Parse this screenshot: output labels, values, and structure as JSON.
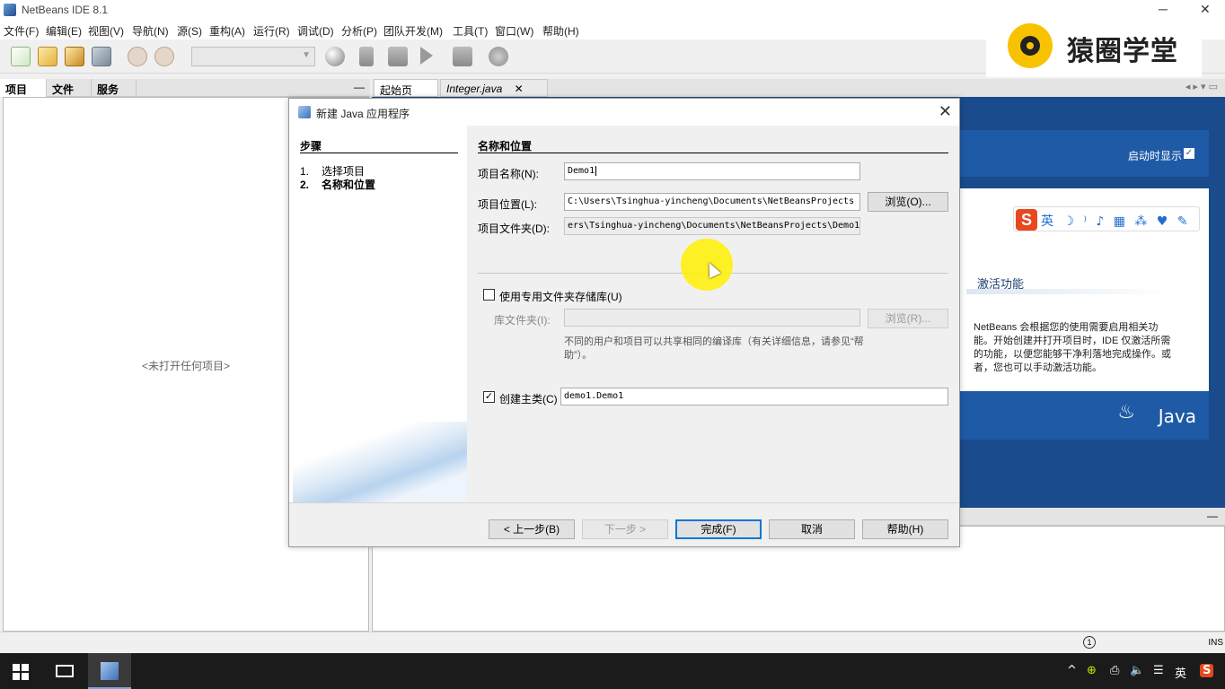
{
  "window": {
    "title": "NetBeans IDE 8.1",
    "minimize": "─",
    "maximize": "▫",
    "close": "✕"
  },
  "menu": [
    "文件(F)",
    "编辑(E)",
    "视图(V)",
    "导航(N)",
    "源(S)",
    "重构(A)",
    "运行(R)",
    "调试(D)",
    "分析(P)",
    "团队开发(M)",
    "工具(T)",
    "窗口(W)",
    "帮助(H)"
  ],
  "watermark": {
    "brand": "猿圈学堂"
  },
  "left_panel": {
    "tabs": [
      "项目",
      "文件",
      "服务"
    ],
    "tab_close": "✕",
    "minimize": "—",
    "empty_text": "<未打开任何项目>"
  },
  "editor": {
    "tabs": [
      {
        "label": "起始页",
        "close": "✕"
      },
      {
        "label": "Integer.java",
        "close": "✕"
      }
    ],
    "nav": "◂ ▸ ▾ ▭"
  },
  "start_page": {
    "show_on_startup": "启动时显示",
    "show_on_startup_checked": "✓",
    "ime_logo": "S",
    "ime_icons": "英 ☽ ⁾ ♪ ▦ ⁂ ♥ ✎",
    "section_title": "激活功能",
    "description": "NetBeans 会根据您的使用需要启用相关功能。开始创建并打开项目时，IDE 仅激活所需的功能，以便您能够干净利落地完成操作。或者，您也可以手动激活功能。",
    "java_logo": "Java",
    "java_cup": "♨"
  },
  "output": {
    "minimize": "—"
  },
  "dialog": {
    "title": "新建 Java 应用程序",
    "close": "✕",
    "steps_title": "步骤",
    "steps": [
      {
        "num": "1.",
        "label": "选择项目"
      },
      {
        "num": "2.",
        "label": "名称和位置"
      }
    ],
    "section_title": "名称和位置",
    "project_name_label": "项目名称(N):",
    "project_name_value": "Demo1",
    "project_location_label": "项目位置(L):",
    "project_location_value": "C:\\Users\\Tsinghua-yincheng\\Documents\\NetBeansProjects",
    "browse_label": "浏览(O)...",
    "project_folder_label": "项目文件夹(D):",
    "project_folder_value": "ers\\Tsinghua-yincheng\\Documents\\NetBeansProjects\\Demo1",
    "use_library_label": "使用专用文件夹存储库(U)",
    "use_library_checked": "",
    "library_folder_label": "库文件夹(I):",
    "library_folder_value": "",
    "library_browse_label": "浏览(R)...",
    "library_note": "不同的用户和项目可以共享相同的编译库（有关详细信息，请参见“帮助”）。",
    "create_main_label": "创建主类(C)",
    "create_main_checked": "✓",
    "main_class_value": "demo1.Demo1",
    "buttons": {
      "back": "< 上一步(B)",
      "next": "下一步 >",
      "finish": "完成(F)",
      "cancel": "取消",
      "help": "帮助(H)"
    }
  },
  "statusbar": {
    "notification": "1",
    "mode": "INS"
  },
  "taskbar": {
    "tray": [
      "^",
      "⊕",
      "⎙",
      "🔈",
      "☰",
      "英",
      "S"
    ]
  }
}
